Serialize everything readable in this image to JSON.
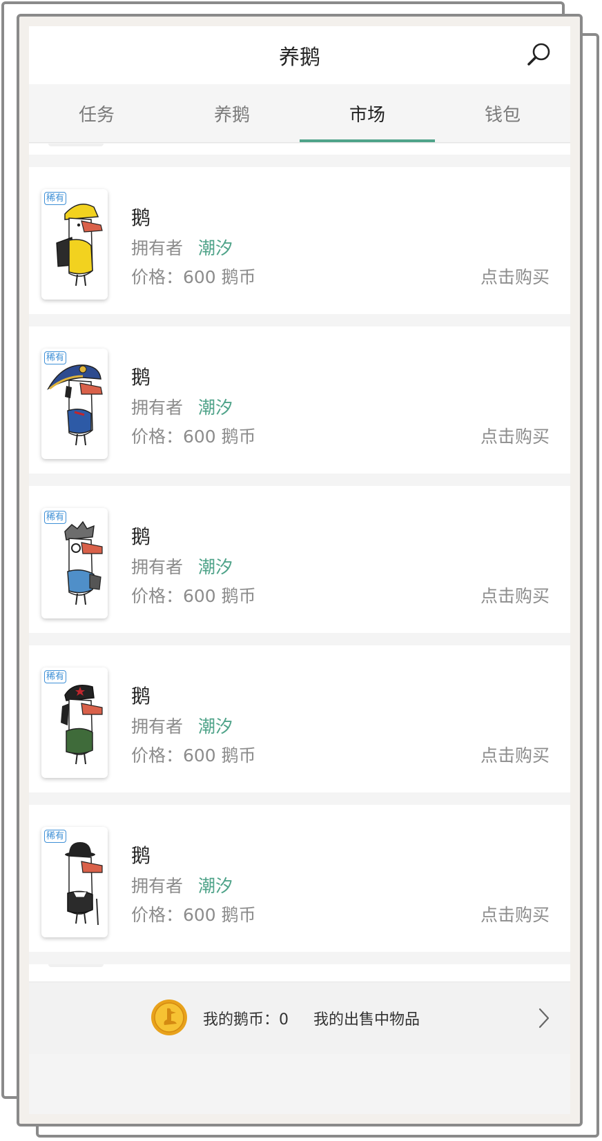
{
  "header": {
    "title": "养鹅",
    "search_icon": "search-icon"
  },
  "tabs": [
    {
      "label": "任务",
      "active": false
    },
    {
      "label": "养鹅",
      "active": false
    },
    {
      "label": "市场",
      "active": true
    },
    {
      "label": "钱包",
      "active": false
    }
  ],
  "colors": {
    "accent": "#4fa389",
    "badge": "#3d8fd6",
    "muted_text": "#8c8c8c"
  },
  "items": [
    {
      "badge": "稀有",
      "name": "鹅",
      "owner_label": "拥有者",
      "owner": "潮汐",
      "price": "价格：600 鹅币",
      "buy": "点击购买",
      "avatar": "goose-yellow-raincoat"
    },
    {
      "badge": "稀有",
      "name": "鹅",
      "owner_label": "拥有者",
      "owner": "潮汐",
      "price": "价格：600 鹅币",
      "buy": "点击购买",
      "avatar": "goose-admiral-hat"
    },
    {
      "badge": "稀有",
      "name": "鹅",
      "owner_label": "拥有者",
      "owner": "潮汐",
      "price": "价格：600 鹅币",
      "buy": "点击购买",
      "avatar": "goose-glasses-laptop"
    },
    {
      "badge": "稀有",
      "name": "鹅",
      "owner_label": "拥有者",
      "owner": "潮汐",
      "price": "价格：600 鹅币",
      "buy": "点击购买",
      "avatar": "goose-beret-green-jacket"
    },
    {
      "badge": "稀有",
      "name": "鹅",
      "owner_label": "拥有者",
      "owner": "潮汐",
      "price": "价格：600 鹅币",
      "buy": "点击购买",
      "avatar": "goose-bowler-hat-cane"
    }
  ],
  "footer": {
    "coin_icon": "goose-coin-icon",
    "my_coins": "我的鹅币：0",
    "my_selling": "我的出售中物品",
    "chevron_icon": "chevron-right-icon"
  }
}
